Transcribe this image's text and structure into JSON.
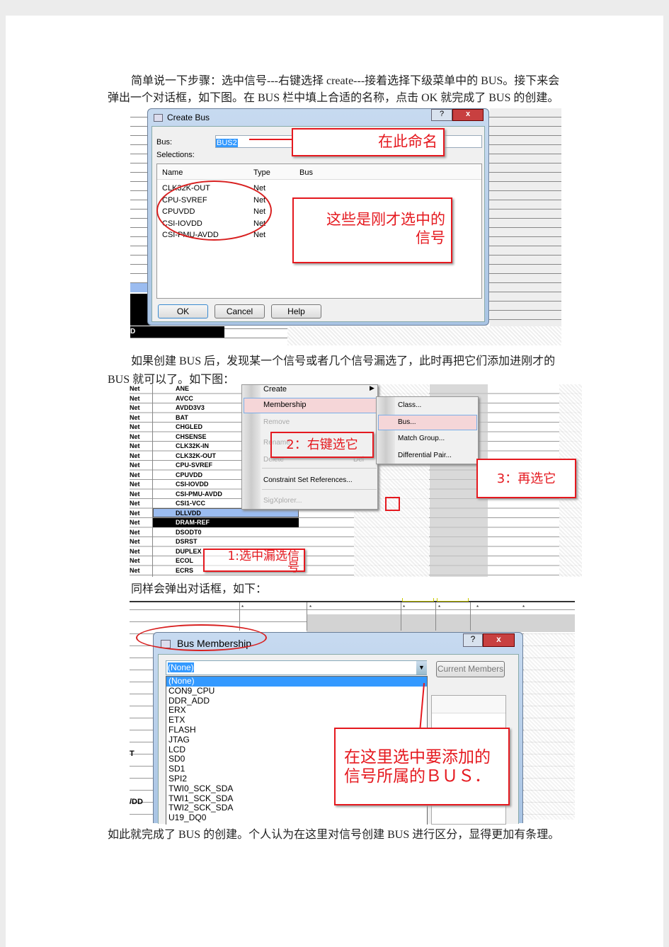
{
  "paragraphs": [
    "简单说一下步骤：选中信号---右键选择 create---接着选择下级菜单中的 BUS。接下来会",
    "弹出一个对话框，如下图。在 BUS 栏中填上合适的名称，点击 OK 就完成了 BUS 的创建。",
    "如果创建 BUS 后，发现某一个信号或者几个信号漏选了，此时再把它们添加进刚才的",
    "BUS 就可以了。如下图：",
    "同样会弹出对话框，如下：",
    "如此就完成了 BUS 的创建。个人认为在这里对信号创建 BUS 进行区分，显得更加有条理。"
  ],
  "fig1": {
    "title": "Create Bus",
    "bus_label": "Bus:",
    "bus_value": "BUS2",
    "selections_label": "Selections:",
    "columns": [
      "Name",
      "Type",
      "Bus"
    ],
    "rows": [
      {
        "name": "CLK32K-OUT",
        "type": "Net"
      },
      {
        "name": "CPU-SVREF",
        "type": "Net"
      },
      {
        "name": "CPUVDD",
        "type": "Net"
      },
      {
        "name": "CSI-IOVDD",
        "type": "Net"
      },
      {
        "name": "CSI-PMU-AVDD",
        "type": "Net"
      }
    ],
    "ok": "OK",
    "cancel": "Cancel",
    "help": "Help",
    "help_icon": "?",
    "close_icon": "x",
    "bg_cell": "D",
    "callout_name": "在此命名",
    "callout_signals_1": "这些是刚才选中的",
    "callout_signals_2": "信号"
  },
  "fig2": {
    "rows": [
      {
        "type": "Net",
        "name": "ANE"
      },
      {
        "type": "Net",
        "name": "AVCC"
      },
      {
        "type": "Net",
        "name": "AVDD3V3"
      },
      {
        "type": "Net",
        "name": "BAT"
      },
      {
        "type": "Net",
        "name": "CHGLED"
      },
      {
        "type": "Net",
        "name": "CHSENSE"
      },
      {
        "type": "Net",
        "name": "CLK32K-IN"
      },
      {
        "type": "Net",
        "name": "CLK32K-OUT"
      },
      {
        "type": "Net",
        "name": "CPU-SVREF"
      },
      {
        "type": "Net",
        "name": "CPUVDD"
      },
      {
        "type": "Net",
        "name": "CSI-IOVDD"
      },
      {
        "type": "Net",
        "name": "CSI-PMU-AVDD"
      },
      {
        "type": "Net",
        "name": "CSI1-VCC"
      },
      {
        "type": "Net",
        "name": "DLLVDD"
      },
      {
        "type": "Net",
        "name": "DRAM-REF"
      },
      {
        "type": "Net",
        "name": "DSODT0"
      },
      {
        "type": "Net",
        "name": "DSRST"
      },
      {
        "type": "Net",
        "name": "DUPLEX"
      },
      {
        "type": "Net",
        "name": "ECOL"
      },
      {
        "type": "Net",
        "name": "ECRS"
      }
    ],
    "menu": {
      "create": "Create",
      "membership": "Membership",
      "remove": "Remove",
      "rename": "Rename",
      "delete": "Delete",
      "delete_shortcut": "Del",
      "constraint": "Constraint Set References...",
      "sigx": "SigXplorer..."
    },
    "submenu": [
      "Class...",
      "Bus...",
      "Match Group...",
      "Differential Pair..."
    ],
    "callout1": "1:选中漏选信",
    "callout1b": "号",
    "callout2": "2：右键选它",
    "callout3": "3：再选它"
  },
  "fig3": {
    "title": "Bus Membership",
    "help_icon": "?",
    "close_icon": "x",
    "selected": "(None)",
    "current_members": "Current Members",
    "options": [
      "(None)",
      "CON9_CPU",
      "DDR_ADD",
      "ERX",
      "ETX",
      "FLASH",
      "JTAG",
      "LCD",
      "SD0",
      "SD1",
      "SPI2",
      "TWI0_SCK_SDA",
      "TWI1_SCK_SDA",
      "TWI2_SCK_SDA",
      "U19_DQ0"
    ],
    "bg_t": "T",
    "bg_vdd": "/DD",
    "callout_1": "在这里选中要添加的",
    "callout_2": "信号所属的ＢＵＳ．"
  },
  "colors": {
    "callout": "#e5191f",
    "selection": "#3399ff",
    "menu_highlight": "#f5d6d8"
  }
}
